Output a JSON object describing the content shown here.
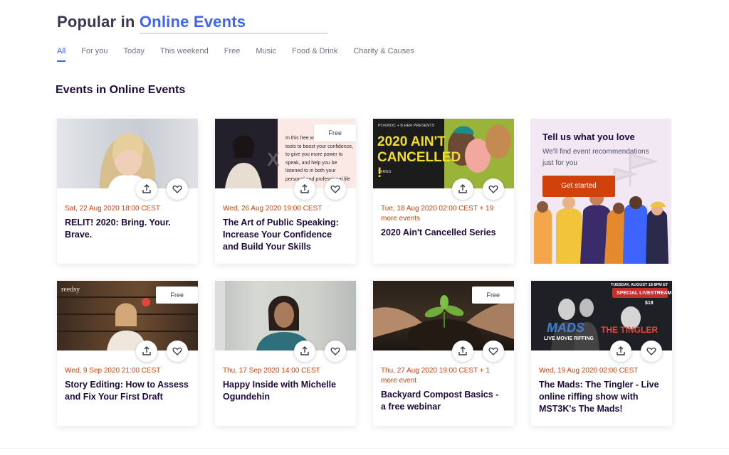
{
  "header": {
    "prefix": "Popular in",
    "accent": "Online Events"
  },
  "tabs": [
    "All",
    "For you",
    "Today",
    "This weekend",
    "Free",
    "Music",
    "Food & Drink",
    "Charity & Causes"
  ],
  "section_title": "Events in Online Events",
  "promo": {
    "heading": "Tell us what you love",
    "subtext": "We'll find event recommendations just for you",
    "button": "Get started"
  },
  "events": [
    {
      "date": "Sat, 22 Aug 2020 18:00 CEST",
      "title": "RELIT! 2020: Bring. Your. Brave.",
      "badge": ""
    },
    {
      "date": "Wed, 26 Aug 2020 19:00 CEST",
      "title": "The Art of Public Speaking: Increase Your Confidence and Build Your Skills",
      "badge": "Free"
    },
    {
      "date": "Tue, 18 Aug 2020 02:00 CEST + 19 more events",
      "title": "2020 Ain't Cancelled Series",
      "badge": ""
    },
    {
      "date": "Wed, 9 Sep 2020 21:00 CEST",
      "title": "Story Editing: How to Assess and Fix Your First Draft",
      "badge": "Free"
    },
    {
      "date": "Thu, 17 Sep 2020 14:00 CEST",
      "title": "Happy Inside with Michelle Ogundehin",
      "badge": ""
    },
    {
      "date": "Thu, 27 Aug 2020 19:00 CEST + 1 more event",
      "title": "Backyard Compost Basics - a free webinar",
      "badge": "Free"
    },
    {
      "date": "Wed, 19 Aug 2020 02:00 CEST",
      "title": "The Mads: The Tingler - Live online riffing show with MST3K's The Mads!",
      "badge": ""
    }
  ],
  "image_text": {
    "speaking_quote": "In this free we you some basic tools to boost your confidence, to give you more power to speak, and help you be listened to in both your personal and professional life",
    "cancelled_presenter": "POXWOC + B.HER PRESENTS",
    "cancelled_title": "2020 AIN'T CANCELLED !",
    "cancelled_sub": "SERIES",
    "reedsy": "reedsy",
    "mads_date": "TUESDAY, AUGUST 18 8PM ET",
    "mads_livestream": "SPECIAL LIVESTREAM",
    "mads_price": "$18",
    "mads_logo": "MADS",
    "mads_riffing": "LIVE MOVIE RIFFING",
    "mads_tingler": "THE TINGLER"
  }
}
